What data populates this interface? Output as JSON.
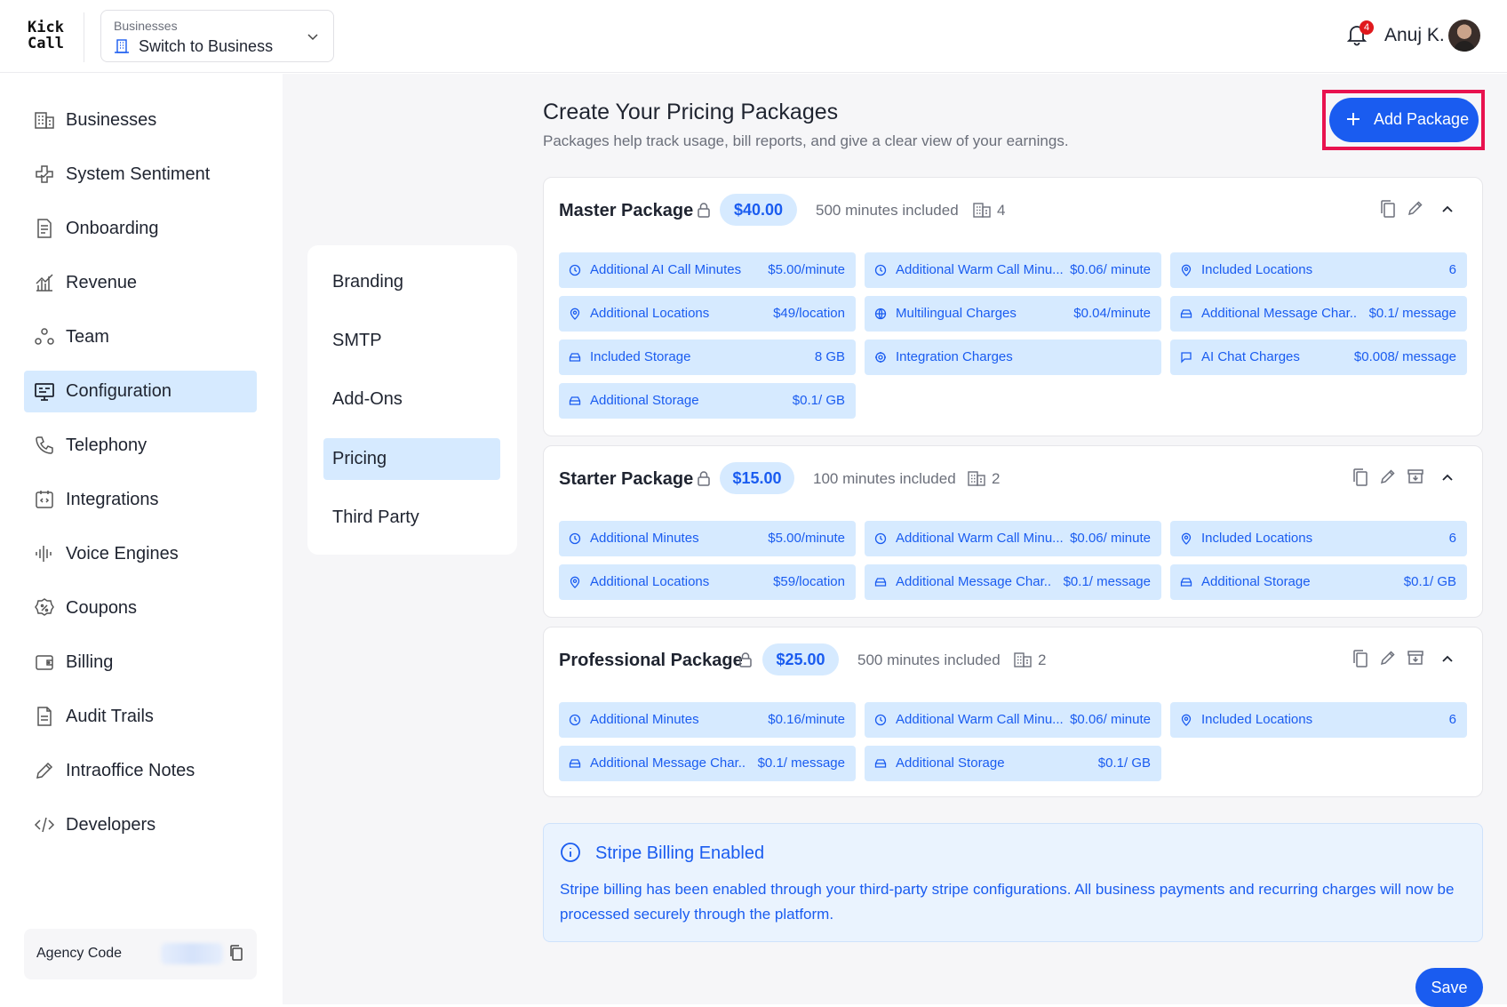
{
  "header": {
    "logo": "Kick\nCall",
    "switcher_label": "Businesses",
    "switcher_value": "Switch to Business",
    "notification_count": "4",
    "user_name": "Anuj K."
  },
  "sidebar": {
    "items": [
      {
        "label": "Businesses",
        "icon": "building-icon"
      },
      {
        "label": "System Sentiment",
        "icon": "sentiment-icon"
      },
      {
        "label": "Onboarding",
        "icon": "document-icon"
      },
      {
        "label": "Revenue",
        "icon": "revenue-chart-icon"
      },
      {
        "label": "Team",
        "icon": "team-icon"
      },
      {
        "label": "Configuration",
        "icon": "configuration-icon",
        "active": true
      },
      {
        "label": "Telephony",
        "icon": "phone-icon"
      },
      {
        "label": "Integrations",
        "icon": "integrations-icon"
      },
      {
        "label": "Voice Engines",
        "icon": "waveform-icon"
      },
      {
        "label": "Coupons",
        "icon": "coupon-icon"
      },
      {
        "label": "Billing",
        "icon": "wallet-icon"
      },
      {
        "label": "Audit Trails",
        "icon": "audit-file-icon"
      },
      {
        "label": "Intraoffice Notes",
        "icon": "pencil-icon"
      },
      {
        "label": "Developers",
        "icon": "code-icon"
      }
    ],
    "agency_code_label": "Agency Code"
  },
  "subnav": {
    "items": [
      {
        "label": "Branding"
      },
      {
        "label": "SMTP"
      },
      {
        "label": "Add-Ons"
      },
      {
        "label": "Pricing",
        "active": true
      },
      {
        "label": "Third Party"
      }
    ]
  },
  "main": {
    "title": "Create Your Pricing Packages",
    "subtitle": "Packages help track usage, bill reports, and give a clear view of your earnings.",
    "add_button": "Add Package",
    "packages": [
      {
        "name": "Master Package",
        "price": "$40.00",
        "minutes": "500 minutes included",
        "business_count": "4",
        "tiles": [
          {
            "name": "Additional AI Call Minutes",
            "value": "$5.00/minute",
            "icon": "clock-icon"
          },
          {
            "name": "Additional Warm Call Minu...",
            "value": "$0.06/ minute",
            "icon": "clock-icon"
          },
          {
            "name": "Included Locations",
            "value": "6",
            "icon": "location-pin-icon"
          },
          {
            "name": "Additional Locations",
            "value": "$49/location",
            "icon": "location-pin-icon"
          },
          {
            "name": "Multilingual Charges",
            "value": "$0.04/minute",
            "icon": "globe-icon"
          },
          {
            "name": "Additional Message Char..",
            "value": "$0.1/ message",
            "icon": "storage-icon"
          },
          {
            "name": "Included Storage",
            "value": "8 GB",
            "icon": "storage-icon"
          },
          {
            "name": "Integration Charges",
            "value": "",
            "icon": "integration-gear-icon"
          },
          {
            "name": "AI Chat Charges",
            "value": "$0.008/ message",
            "icon": "chat-icon"
          },
          {
            "name": "Additional Storage",
            "value": "$0.1/ GB",
            "icon": "storage-icon"
          }
        ]
      },
      {
        "name": "Starter Package",
        "price": "$15.00",
        "minutes": "100 minutes included",
        "business_count": "2",
        "tiles": [
          {
            "name": "Additional Minutes",
            "value": "$5.00/minute",
            "icon": "clock-icon"
          },
          {
            "name": "Additional Warm Call Minu...",
            "value": "$0.06/ minute",
            "icon": "clock-icon"
          },
          {
            "name": "Included Locations",
            "value": "6",
            "icon": "location-pin-icon"
          },
          {
            "name": "Additional Locations",
            "value": "$59/location",
            "icon": "location-pin-icon"
          },
          {
            "name": "Additional Message Char..",
            "value": "$0.1/ message",
            "icon": "storage-icon"
          },
          {
            "name": "Additional Storage",
            "value": "$0.1/ GB",
            "icon": "storage-icon"
          }
        ]
      },
      {
        "name": "Professional Package",
        "price": "$25.00",
        "minutes": "500 minutes included",
        "business_count": "2",
        "tiles": [
          {
            "name": "Additional Minutes",
            "value": "$0.16/minute",
            "icon": "clock-icon"
          },
          {
            "name": "Additional Warm Call Minu...",
            "value": "$0.06/ minute",
            "icon": "clock-icon"
          },
          {
            "name": "Included Locations",
            "value": "6",
            "icon": "location-pin-icon"
          },
          {
            "name": "Additional Message Char..",
            "value": "$0.1/ message",
            "icon": "storage-icon"
          },
          {
            "name": "Additional Storage",
            "value": "$0.1/ GB",
            "icon": "storage-icon"
          }
        ]
      }
    ],
    "stripe": {
      "title": "Stripe Billing Enabled",
      "body": "Stripe billing has been enabled through your third-party stripe configurations. All business payments and recurring charges will now be processed securely through the platform."
    },
    "save_button": "Save"
  },
  "colors": {
    "accent": "#1a5cf0",
    "tile_bg": "#d6eaff",
    "highlight_box": "#e8124f",
    "badge": "#e0191d"
  }
}
